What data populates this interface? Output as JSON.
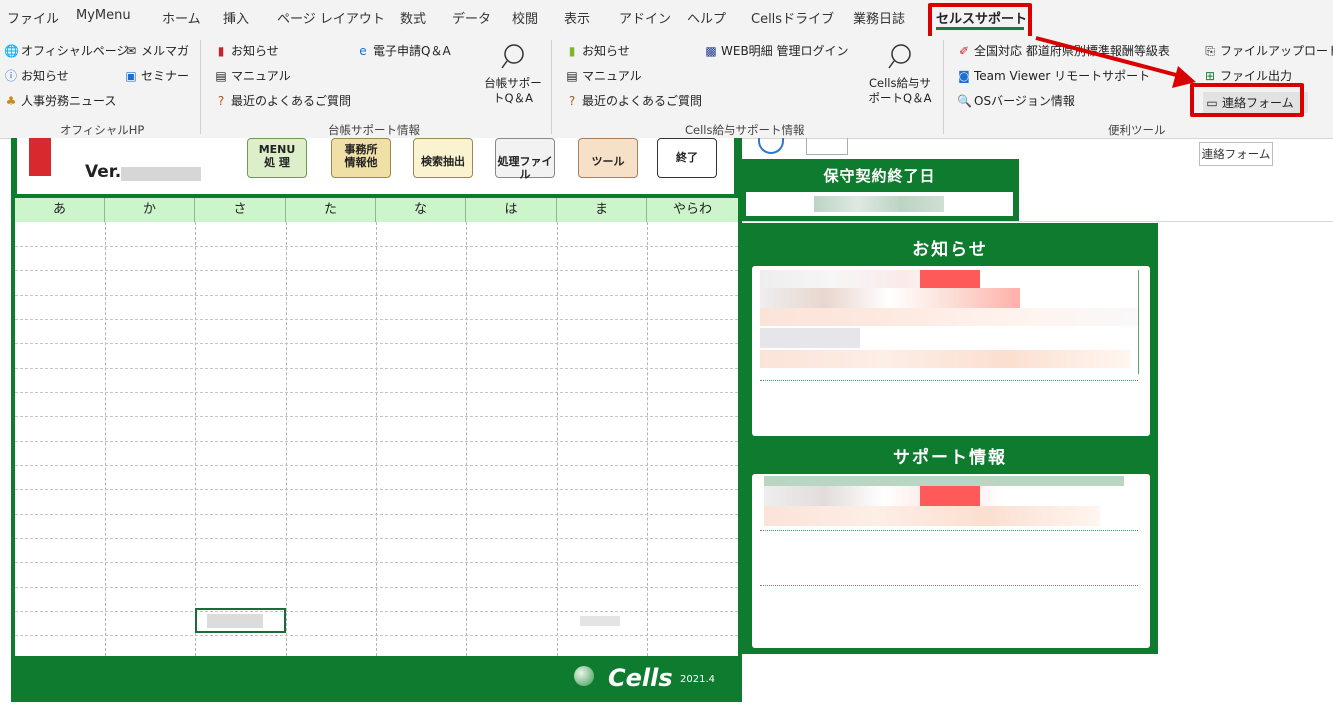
{
  "tabs": [
    "ファイル",
    "MyMenu",
    "ホーム",
    "挿入",
    "ページ レイアウト",
    "数式",
    "データ",
    "校閲",
    "表示",
    "アドイン",
    "ヘルプ",
    "Cellsドライブ",
    "業務日誌",
    "セルスサポート"
  ],
  "official": {
    "items": [
      "オフィシャルページ",
      "メルマガ",
      "お知らせ",
      "セミナー",
      "人事労務ニュース"
    ],
    "label": "オフィシャルHP"
  },
  "daicho": {
    "items": [
      "お知らせ",
      "マニュアル",
      "最近のよくあるご質問",
      "電子申請Q＆A"
    ],
    "big_line1": "台帳サポー",
    "big_line2": "トQ＆A",
    "label": "台帳サポート情報"
  },
  "cells_kyuyo": {
    "items": [
      "お知らせ",
      "マニュアル",
      "最近のよくあるご質問",
      "WEB明細 管理ログイン"
    ],
    "big_line1": "Cells給与サ",
    "big_line2": "ポートQ＆A",
    "label": "Cells給与サポート情報"
  },
  "benri": {
    "items": [
      "全国対応 都道府県別標準報酬等級表",
      "ファイルアップロード",
      "Team Viewer リモートサポート",
      "ファイル出力",
      "OSバージョン情報",
      "連絡フォーム"
    ],
    "label": "便利ツール"
  },
  "tooltip": "連絡フォーム",
  "sheet": {
    "ver_label": "Ver.",
    "buttons": [
      {
        "l1": "MENU",
        "l2": "処 理"
      },
      {
        "l1": "事務所",
        "l2": "情報他"
      },
      {
        "l1": "",
        "l2": "検索抽出"
      },
      {
        "l1": "",
        "l2": "処理ファイル"
      },
      {
        "l1": "",
        "l2": "ツール"
      },
      {
        "l1": "",
        "l2": "終了"
      }
    ],
    "headers": [
      "あ",
      "か",
      "さ",
      "た",
      "な",
      "は",
      "ま",
      "やらわ"
    ],
    "brand": "Cells",
    "version": "2021.4"
  },
  "right": {
    "maintenance_title": "保守契約終了日",
    "notice_title": "お知らせ",
    "support_title": "サポート情報"
  },
  "colors": {
    "green": "#0f7b2e",
    "header_green": "#ccf5cc",
    "highlight": "#d90000"
  }
}
